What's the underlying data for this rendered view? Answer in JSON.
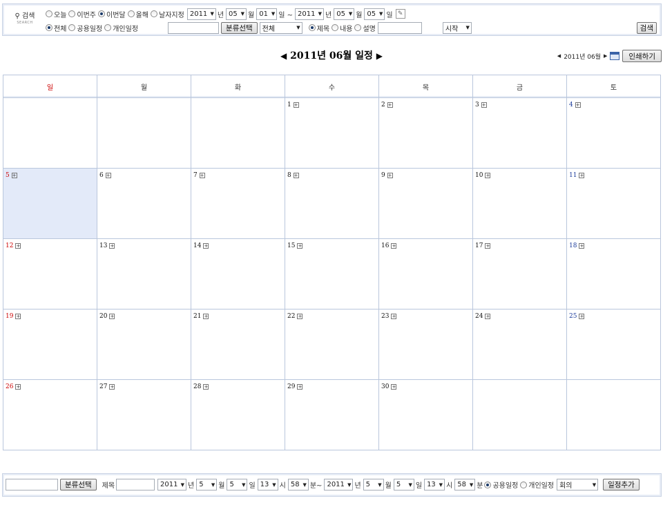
{
  "search": {
    "logo_text": "검색",
    "logo_sub": "SEARCH",
    "period_options": [
      {
        "label": "오늘",
        "selected": false
      },
      {
        "label": "이번주",
        "selected": false
      },
      {
        "label": "이번달",
        "selected": true
      },
      {
        "label": "올해",
        "selected": false
      },
      {
        "label": "날자지정",
        "selected": false
      }
    ],
    "from_year": "2011",
    "year_unit": "년",
    "from_month": "05",
    "month_unit": "월",
    "from_day": "01",
    "day_unit_tilde": "일 ~",
    "to_year": "2011",
    "to_month": "05",
    "to_day": "05",
    "day_unit": "일",
    "scope_options": [
      {
        "label": "전체",
        "selected": true
      },
      {
        "label": "공용일정",
        "selected": false
      },
      {
        "label": "개인일정",
        "selected": false
      }
    ],
    "category_button": "분류선택",
    "category_select": "전체",
    "field_options": [
      {
        "label": "제목",
        "selected": true
      },
      {
        "label": "내용",
        "selected": false
      },
      {
        "label": "설명",
        "selected": false
      }
    ],
    "match_select": "시작",
    "search_button": "검색"
  },
  "header": {
    "prev": "◀",
    "title": "2011년 06월 일정",
    "next": "▶",
    "mini_prev": "◀",
    "mini_label": "2011년 06월",
    "mini_next": "▶",
    "print_button": "인쇄하기"
  },
  "calendar": {
    "weekdays": [
      "일",
      "월",
      "화",
      "수",
      "목",
      "금",
      "토"
    ],
    "weeks": [
      [
        "",
        "",
        "",
        "1",
        "2",
        "3",
        "4"
      ],
      [
        "5",
        "6",
        "7",
        "8",
        "9",
        "10",
        "11"
      ],
      [
        "12",
        "13",
        "14",
        "15",
        "16",
        "17",
        "18"
      ],
      [
        "19",
        "20",
        "21",
        "22",
        "23",
        "24",
        "25"
      ],
      [
        "26",
        "27",
        "28",
        "29",
        "30",
        "",
        ""
      ]
    ],
    "today": "5",
    "colors": {
      "sunday": "#cc0000",
      "saturday": "#1a3a9a",
      "today_bg": "#e3eaf9",
      "border": "#b9c6dc"
    }
  },
  "add_form": {
    "category_button": "분류선택",
    "title_label": "제목",
    "start_year": "2011",
    "year_unit": "년",
    "start_month": "5",
    "month_unit": "월",
    "start_day": "5",
    "day_unit": "일",
    "start_hour": "13",
    "hour_unit": "시",
    "start_min": "58",
    "min_unit_tilde": "분~",
    "end_year": "2011",
    "end_month": "5",
    "end_day": "5",
    "end_hour": "13",
    "end_min": "58",
    "min_unit": "분",
    "scope_options": [
      {
        "label": "공용일정",
        "selected": true
      },
      {
        "label": "개인일정",
        "selected": false
      }
    ],
    "type_select": "회의",
    "add_button": "일정추가"
  }
}
